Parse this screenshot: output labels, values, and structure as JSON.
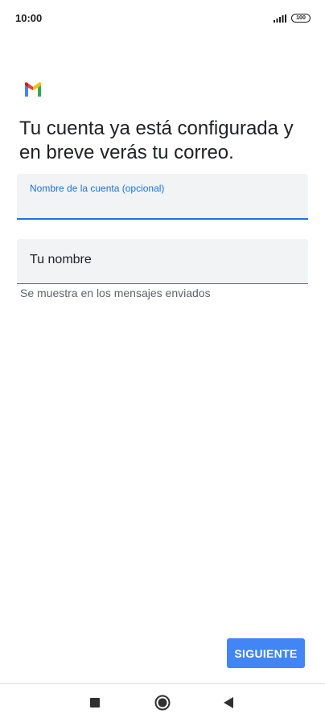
{
  "status_bar": {
    "time": "10:00",
    "battery": "100",
    "signal_icon": "signal-icon"
  },
  "app": {
    "logo_icon": "gmail-logo-icon",
    "heading": "Tu cuenta ya está configurada y en breve verás tu correo."
  },
  "form": {
    "account_name": {
      "label": "Nombre de la cuenta (opcional)",
      "value": ""
    },
    "your_name": {
      "placeholder": "Tu nombre",
      "value": "",
      "helper": "Se muestra en los mensajes enviados"
    }
  },
  "actions": {
    "next_label": "SIGUIENTE"
  },
  "navigation": {
    "recent_icon": "square-icon",
    "home_icon": "circle-home-icon",
    "back_icon": "triangle-back-icon"
  },
  "colors": {
    "accent": "#1a73e8",
    "button": "#4285f4",
    "field_background": "#f1f3f4"
  }
}
